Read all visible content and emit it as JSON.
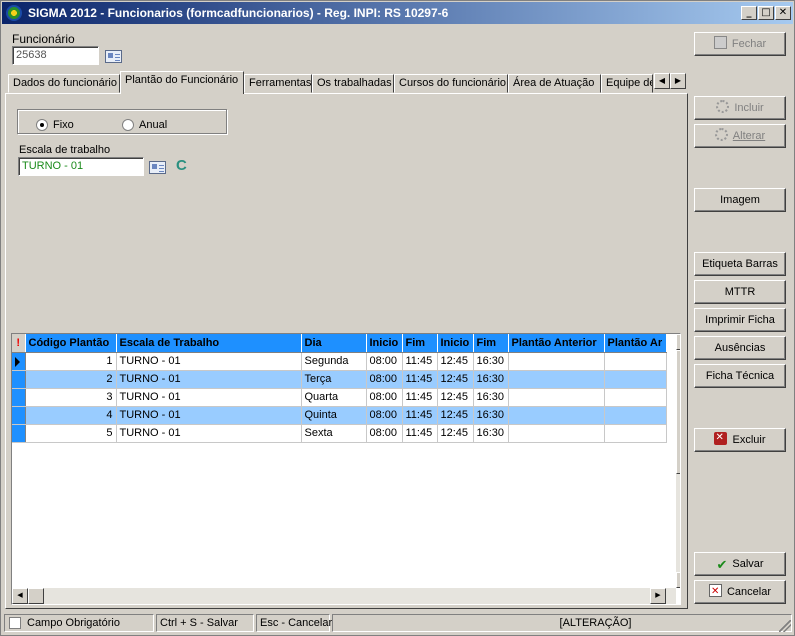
{
  "window": {
    "title": "SIGMA 2012 - Funcionarios  (formcadfuncionarios)  - Reg. INPI: RS 10297-6"
  },
  "funcionario": {
    "label": "Funcionário",
    "value": "25638"
  },
  "tabs": [
    {
      "label": "Dados do funcionário"
    },
    {
      "label": "Plantão do Funcionário"
    },
    {
      "label": "Ferramentas"
    },
    {
      "label": "Os trabalhadas"
    },
    {
      "label": "Cursos do funcionário"
    },
    {
      "label": "Área de Atuação"
    },
    {
      "label": "Equipe de"
    }
  ],
  "plantao": {
    "radio_fixo": "Fixo",
    "radio_anual": "Anual",
    "selected": "Fixo",
    "escala_label": "Escala de trabalho",
    "escala_value": "TURNO - 01"
  },
  "grid": {
    "indicator": "!",
    "columns": [
      "Código Plantão",
      "Escala de Trabalho",
      "Dia",
      "Inicio",
      "Fim",
      "Inicio",
      "Fim",
      "Plantão Anterior",
      "Plantão Ar"
    ],
    "rows": [
      {
        "codigo": "1",
        "escala": "TURNO - 01",
        "dia": "Segunda",
        "inicio1": "08:00",
        "fim1": "11:45",
        "inicio2": "12:45",
        "fim2": "16:30",
        "anterior": "",
        "ar": ""
      },
      {
        "codigo": "2",
        "escala": "TURNO - 01",
        "dia": "Terça",
        "inicio1": "08:00",
        "fim1": "11:45",
        "inicio2": "12:45",
        "fim2": "16:30",
        "anterior": "",
        "ar": ""
      },
      {
        "codigo": "3",
        "escala": "TURNO - 01",
        "dia": "Quarta",
        "inicio1": "08:00",
        "fim1": "11:45",
        "inicio2": "12:45",
        "fim2": "16:30",
        "anterior": "",
        "ar": ""
      },
      {
        "codigo": "4",
        "escala": "TURNO - 01",
        "dia": "Quinta",
        "inicio1": "08:00",
        "fim1": "11:45",
        "inicio2": "12:45",
        "fim2": "16:30",
        "anterior": "",
        "ar": ""
      },
      {
        "codigo": "5",
        "escala": "TURNO - 01",
        "dia": "Sexta",
        "inicio1": "08:00",
        "fim1": "11:45",
        "inicio2": "12:45",
        "fim2": "16:30",
        "anterior": "",
        "ar": ""
      }
    ]
  },
  "buttons": {
    "fechar": "Fechar",
    "incluir": "Incluir",
    "alterar": "Alterar",
    "imagem": "Imagem",
    "etiqueta": "Etiqueta Barras",
    "mttr": "MTTR",
    "imprimir": "Imprimir Ficha",
    "ausencias": "Ausências",
    "ficha": "Ficha Técnica",
    "excluir": "Excluir",
    "salvar": "Salvar",
    "cancelar": "Cancelar"
  },
  "statusbar": {
    "campo": "Campo Obrigatório",
    "salvar": "Ctrl + S - Salvar",
    "cancelar": "Esc - Cancelar",
    "modo": "[ALTERAÇÃO]"
  },
  "colors": {
    "title_start": "#0a246a",
    "grid_header": "#1e90ff",
    "row_alt": "#99ccff"
  }
}
